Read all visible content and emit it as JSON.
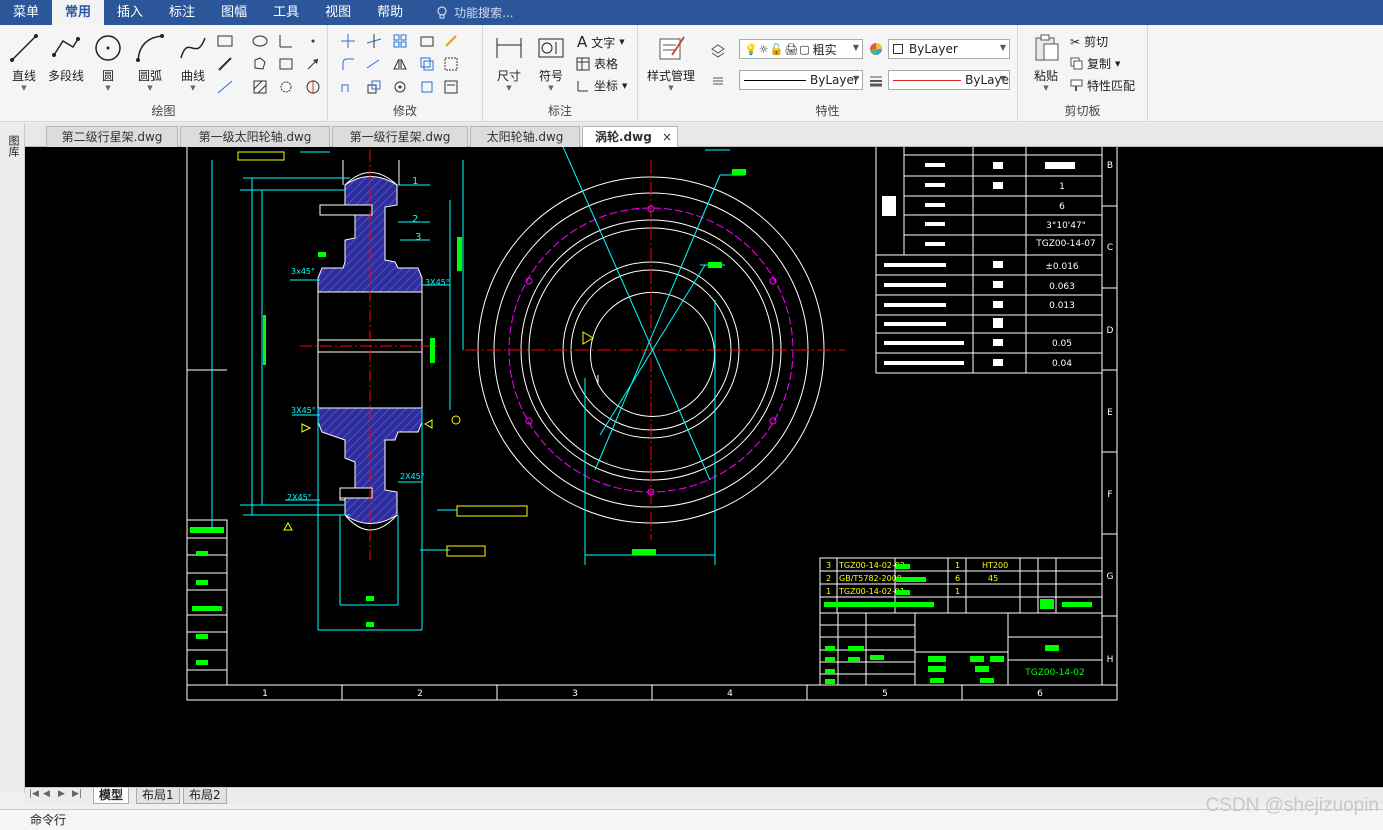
{
  "menu": {
    "items": [
      "菜单",
      "常用",
      "插入",
      "标注",
      "图幅",
      "工具",
      "视图",
      "帮助"
    ],
    "active": "常用",
    "search_placeholder": "功能搜索..."
  },
  "ribbon": {
    "draw": {
      "title": "绘图",
      "line": "直线",
      "polyline": "多段线",
      "circle": "圆",
      "arc": "圆弧",
      "curve": "曲线"
    },
    "modify": {
      "title": "修改"
    },
    "annotate": {
      "title": "标注",
      "dimension": "尺寸",
      "symbol": "符号",
      "text": "文字",
      "table": "表格",
      "coord": "坐标"
    },
    "properties": {
      "title": "特性",
      "style_mgr": "样式管理",
      "layer_name": "粗实",
      "color": "ByLayer",
      "linetype": "ByLayer",
      "lineweight": "ByLaye"
    },
    "clipboard": {
      "title": "剪切板",
      "paste": "粘贴",
      "cut": "剪切",
      "copy": "复制",
      "match": "特性匹配"
    }
  },
  "doc_tabs": [
    "第二级行星架.dwg",
    "第一级太阳轮轴.dwg",
    "第一级行星架.dwg",
    "太阳轮轴.dwg",
    "涡轮.dwg"
  ],
  "active_doc": "涡轮.dwg",
  "sidebar": {
    "label": "图库"
  },
  "layout_tabs": [
    "模型",
    "布局1",
    "布局2"
  ],
  "active_layout": "模型",
  "cmd": {
    "label": "命令行"
  },
  "watermark": "CSDN @shejizuopin",
  "drawing": {
    "callouts": [
      "1",
      "2",
      "3"
    ],
    "chamfers": [
      "3x45°",
      "3X45°",
      "3X45°",
      "2X45°",
      "2X45°"
    ],
    "zone_cols": [
      "1",
      "2",
      "3",
      "4",
      "5",
      "6"
    ],
    "zone_rows": [
      "B",
      "C",
      "D",
      "E",
      "F",
      "G",
      "H"
    ],
    "param_values": [
      "1",
      "6",
      "3°10'47\"",
      "TGZ00-14-07",
      "±0.016",
      "0.063",
      "0.013",
      "0.05",
      "0.04"
    ],
    "bom": [
      {
        "no": "3",
        "code": "TGZ00-14-02-02",
        "qty": "1",
        "mat": "HT200"
      },
      {
        "no": "2",
        "code": "GB/T5782-2000",
        "qty": "6",
        "mat": "45"
      },
      {
        "no": "1",
        "code": "TGZ00-14-02-01",
        "qty": "1",
        "mat": ""
      }
    ],
    "drawing_no": "TGZ00-14-02"
  },
  "colors": {
    "menubar": "#2b579a",
    "canvas": "#000000",
    "cad_white": "#ffffff",
    "cad_green": "#00ff00",
    "cad_cyan": "#00ffff",
    "cad_red": "#ff0000",
    "cad_magenta": "#ff00ff",
    "cad_yellow": "#ffff00",
    "hatch": "#3a3aa8"
  }
}
